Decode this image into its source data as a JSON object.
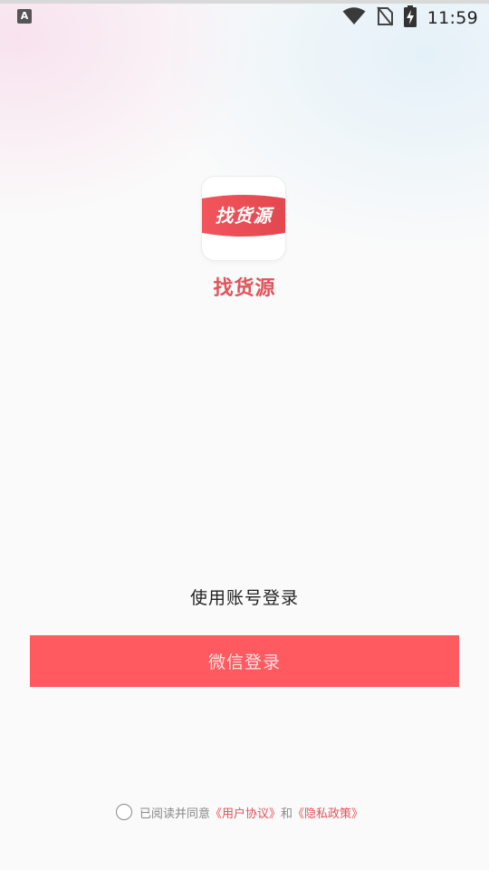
{
  "status_bar": {
    "left_icon_letter": "A",
    "time": "11:59",
    "icons": [
      "wifi-icon",
      "no-sim-icon",
      "battery-charging-icon"
    ]
  },
  "app": {
    "logo_text": "找货源",
    "name": "找货源"
  },
  "login": {
    "account_login_label": "使用账号登录",
    "wechat_button_label": "微信登录"
  },
  "agreement": {
    "prefix": "已阅读并同意",
    "user_agreement": "《用户协议》",
    "conjunction": "和",
    "privacy_policy": "《隐私政策》",
    "checked": false
  },
  "colors": {
    "accent": "#ff5a5f",
    "brand_text": "#e0545a",
    "background": "#fafafa"
  }
}
